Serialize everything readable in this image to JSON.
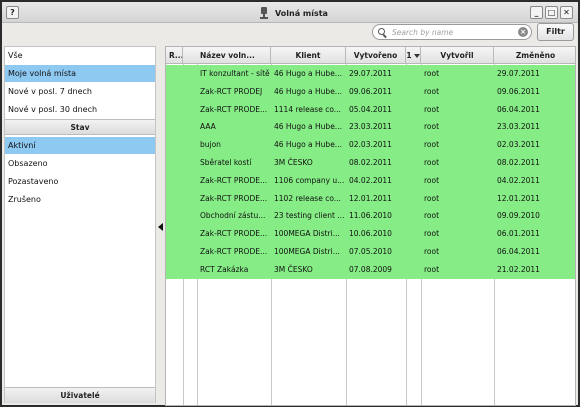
{
  "window": {
    "title": "Volná místa",
    "help_label": "?",
    "minimize_label": "_",
    "maximize_label": "□",
    "close_label": "✕"
  },
  "toolbar": {
    "search_placeholder": "Search by name",
    "search_value": "",
    "clear_label": "×",
    "filter_label": "Filtr"
  },
  "sidebar": {
    "views": [
      {
        "label": "Vše",
        "selected": false
      },
      {
        "label": "Moje volná místa",
        "selected": true
      },
      {
        "label": "Nové v posl. 7 dnech",
        "selected": false
      },
      {
        "label": "Nové v posl. 30 dnech",
        "selected": false
      }
    ],
    "state_header": "Stav",
    "states": [
      {
        "label": "Aktivní",
        "selected": true
      },
      {
        "label": "Obsazeno",
        "selected": false
      },
      {
        "label": "Pozastaveno",
        "selected": false
      },
      {
        "label": "Zrušeno",
        "selected": false
      }
    ],
    "footer_label": "Uživatelé"
  },
  "table": {
    "columns": [
      "R...",
      "Název voln...",
      "Klient",
      "Vytvořeno",
      "1",
      "Vytvořil",
      "Změněno"
    ],
    "row_color": "#86ec86",
    "rows": [
      [
        "",
        "IT konzultant - sítě",
        "46 Hugo a Hube...",
        "29.07.2011",
        "",
        "root",
        "29.07.2011"
      ],
      [
        "",
        "Zak-RCT PRODEJ",
        "46 Hugo a Hube...",
        "09.06.2011",
        "",
        "root",
        "09.06.2011"
      ],
      [
        "",
        "Zak-RCT PRODE...",
        "1114 release co...",
        "05.04.2011",
        "",
        "root",
        "06.04.2011"
      ],
      [
        "",
        "AAA",
        "46 Hugo a Hube...",
        "23.03.2011",
        "",
        "root",
        "23.03.2011"
      ],
      [
        "",
        "bujon",
        "46 Hugo a Hube...",
        "02.03.2011",
        "",
        "root",
        "02.03.2011"
      ],
      [
        "",
        "Sběratel kostí",
        "3M ČESKO",
        "08.02.2011",
        "",
        "root",
        "08.02.2011"
      ],
      [
        "",
        "Zak-RCT PRODE...",
        "1106 company u...",
        "04.02.2011",
        "",
        "root",
        "04.02.2011"
      ],
      [
        "",
        "Zak-RCT PRODE...",
        "1102 release co...",
        "12.01.2011",
        "",
        "root",
        "12.01.2011"
      ],
      [
        "",
        "Obchodní zástu...",
        "23 testing client ...",
        "11.06.2010",
        "",
        "root",
        "09.09.2010"
      ],
      [
        "",
        "Zak-RCT PRODE...",
        "100MEGA Distri...",
        "10.06.2010",
        "",
        "root",
        "06.01.2011"
      ],
      [
        "",
        "Zak-RCT PRODE...",
        "100MEGA Distri...",
        "07.05.2010",
        "",
        "root",
        "06.04.2011"
      ],
      [
        "",
        "RCT Zakázka",
        "3M ČESKO",
        "07.08.2009",
        "",
        "root",
        "21.02.2011"
      ]
    ]
  }
}
